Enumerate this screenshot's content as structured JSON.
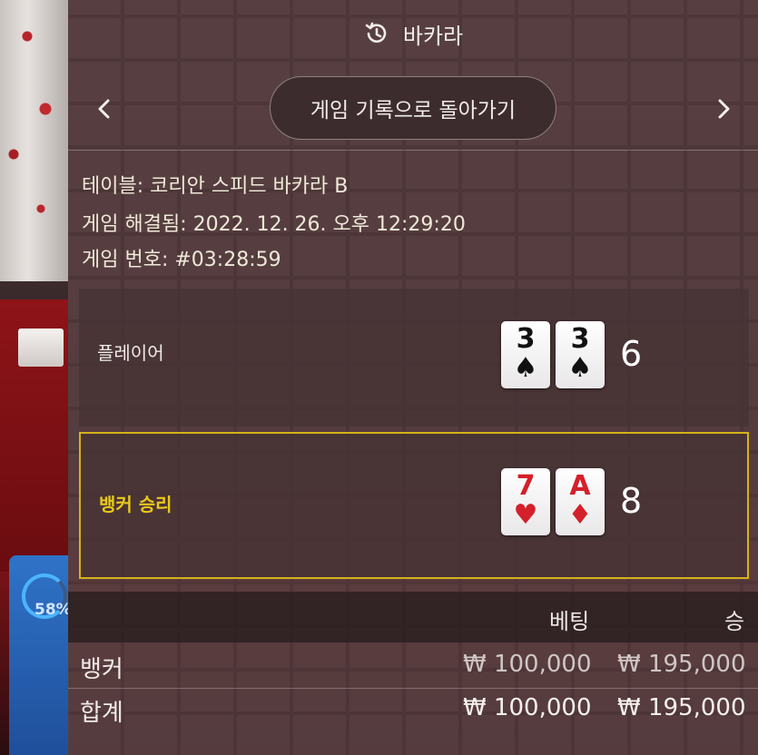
{
  "header": {
    "title": "바카라",
    "icon": "history-icon"
  },
  "nav": {
    "back_label": "게임 기록으로 돌아가기",
    "prev_icon": "chevron-left-icon",
    "next_icon": "chevron-right-icon"
  },
  "info": {
    "table": "테이블: 코리안 스피드 바카라 B",
    "resolved": "게임 해결됨: 2022. 12. 26. 오후 12:29:20",
    "round": "게임 번호: #03:28:59"
  },
  "player": {
    "label": "플레이어",
    "cards": [
      {
        "rank": "3",
        "suit": "♠"
      },
      {
        "rank": "3",
        "suit": "♠"
      }
    ],
    "score": "6"
  },
  "banker": {
    "label": "뱅커 승리",
    "cards": [
      {
        "rank": "7",
        "suit": "♥"
      },
      {
        "rank": "A",
        "suit": "♦"
      }
    ],
    "score": "8",
    "highlight_color": "#d4b21a"
  },
  "results": {
    "headers": {
      "bet": "베팅",
      "win": "승"
    },
    "rows": [
      {
        "label": "뱅커",
        "bet": "₩ 100,000",
        "win": "₩ 195,000"
      },
      {
        "label": "합계",
        "bet": "₩ 100,000",
        "win": "₩ 195,000"
      }
    ]
  },
  "background": {
    "timer_percent": "58%"
  }
}
